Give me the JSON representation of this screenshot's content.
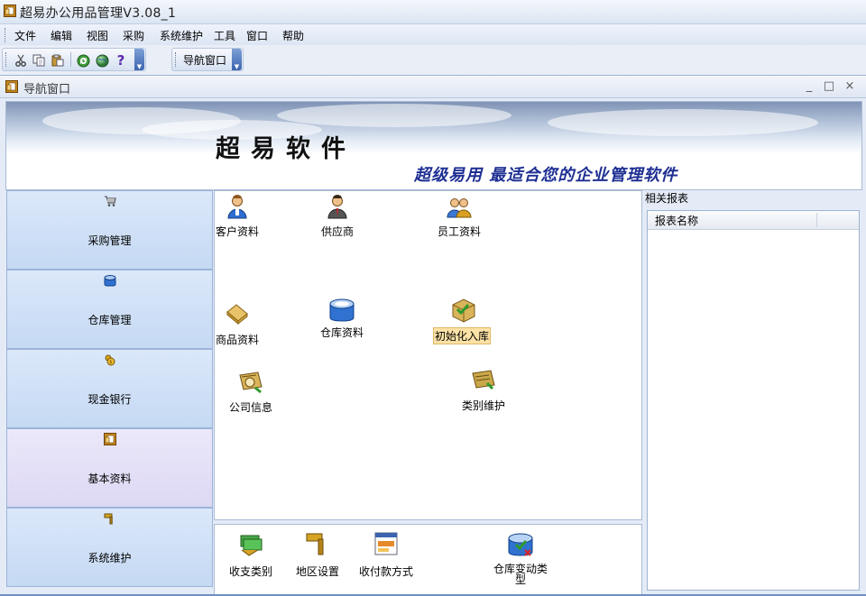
{
  "app": {
    "title": "超易办公用品管理V3.08_1"
  },
  "menu": [
    "文件",
    "编辑",
    "视图",
    "采购",
    "系统维护",
    "工具",
    "窗口",
    "帮助"
  ],
  "toolbar": {
    "icons": [
      "cut-icon",
      "copy-icon",
      "paste-icon",
      "refresh-icon",
      "globe-icon",
      "help-icon"
    ],
    "nav_window_label": "导航窗口"
  },
  "child_window": {
    "title": "导航窗口",
    "controls": [
      "_",
      "□",
      "×"
    ]
  },
  "banner": {
    "title": "超易软件",
    "slogan": "超级易用 最适合您的企业管理软件"
  },
  "left_nav": {
    "items": [
      {
        "label": "采购管理",
        "icon": "cart-icon",
        "active": false
      },
      {
        "label": "仓库管理",
        "icon": "warehouse-icon",
        "active": false
      },
      {
        "label": "现金银行",
        "icon": "money-icon",
        "active": false
      },
      {
        "label": "基本资料",
        "icon": "basic-data-icon",
        "active": true
      },
      {
        "label": "系统维护",
        "icon": "hammer-icon",
        "active": false
      }
    ]
  },
  "main_tiles": [
    {
      "label": "客户资料",
      "icon": "customer-icon"
    },
    {
      "label": "供应商",
      "icon": "supplier-icon"
    },
    {
      "label": "员工资料",
      "icon": "employee-icon"
    },
    {
      "label": "商品资料",
      "icon": "goods-icon"
    },
    {
      "label": "仓库资料",
      "icon": "warehouse-data-icon"
    },
    {
      "label": "初始化入库",
      "icon": "init-stock-icon",
      "highlighted": true
    },
    {
      "label": "公司信息",
      "icon": "company-info-icon"
    },
    {
      "label": "类别维护",
      "icon": "category-icon"
    }
  ],
  "bottom_tiles": [
    {
      "label": "收支类别",
      "icon": "income-expense-icon"
    },
    {
      "label": "地区设置",
      "icon": "region-icon"
    },
    {
      "label": "收付款方式",
      "icon": "payment-method-icon"
    },
    {
      "label": "仓库变动类型",
      "icon": "stock-change-icon"
    }
  ],
  "reports": {
    "title": "相关报表",
    "column_header": "报表名称",
    "rows": []
  }
}
